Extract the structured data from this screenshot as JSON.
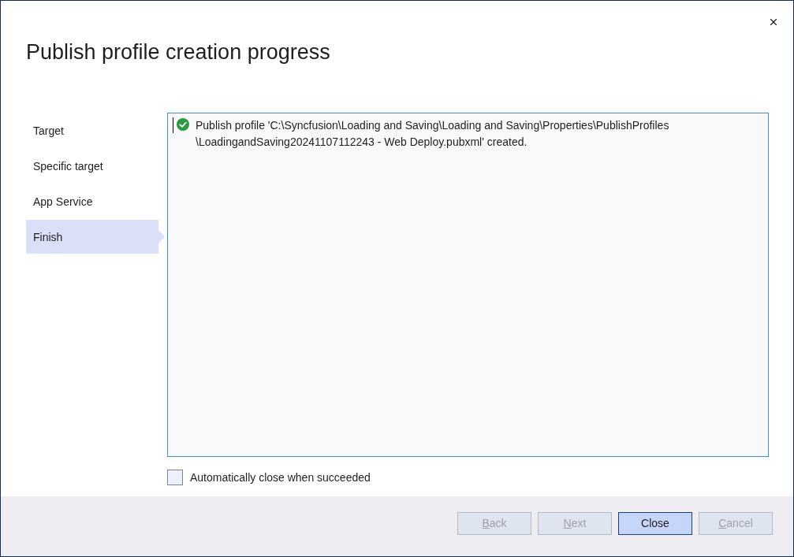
{
  "window": {
    "title": "Publish profile creation progress"
  },
  "steps": [
    {
      "label": "Target",
      "selected": false
    },
    {
      "label": "Specific target",
      "selected": false
    },
    {
      "label": "App Service",
      "selected": false
    },
    {
      "label": "Finish",
      "selected": true
    }
  ],
  "log": {
    "focused": true,
    "entries": [
      {
        "kind": "success",
        "lines": [
          "Publish profile 'C:\\Syncfusion\\Loading and Saving\\Loading and Saving\\Properties\\PublishProfiles",
          "\\LoadingandSaving20241107112243 - Web Deploy.pubxml' created."
        ]
      }
    ]
  },
  "auto_close": {
    "label": "Automatically close when succeeded",
    "checked": false
  },
  "buttons": [
    {
      "label": "Back",
      "disabled": true,
      "default": false,
      "mnemonic": true
    },
    {
      "label": "Next",
      "disabled": true,
      "default": false,
      "mnemonic": true
    },
    {
      "label": "Close",
      "disabled": false,
      "default": true,
      "mnemonic": false
    },
    {
      "label": "Cancel",
      "disabled": true,
      "default": false,
      "mnemonic": true
    }
  ]
}
